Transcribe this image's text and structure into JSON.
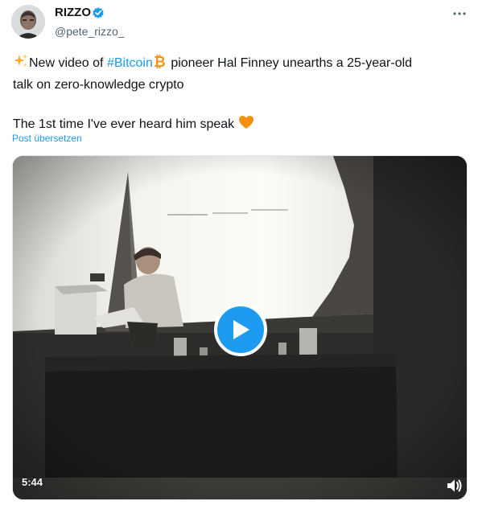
{
  "author": {
    "name": "RIZZO",
    "handle": "@pete_rizzo_"
  },
  "icons": {
    "avatar": "avatar-photo",
    "verified": "verified-badge-icon",
    "more": "more-dots-icon",
    "sparkles": "sparkles-icon",
    "bitcoin": "bitcoin-icon",
    "heart": "orange-heart-icon",
    "play": "play-icon",
    "sound": "volume-icon"
  },
  "tweet": {
    "line1_prefix": "New video of",
    "hashtag": "#Bitcoin",
    "line1_suffix": "pioneer Hal Finney unearths a 25-year-old",
    "line2": "talk on zero-knowledge crypto",
    "line3": "The 1st time I've ever heard him speak",
    "translate_label": "Post übersetzen"
  },
  "video": {
    "duration": "5:44"
  },
  "colors": {
    "accent": "#1d9bf0",
    "text": "#0f1419",
    "secondary": "#536471",
    "bitcoin": "#f7931a",
    "heart": "#f4900c"
  }
}
